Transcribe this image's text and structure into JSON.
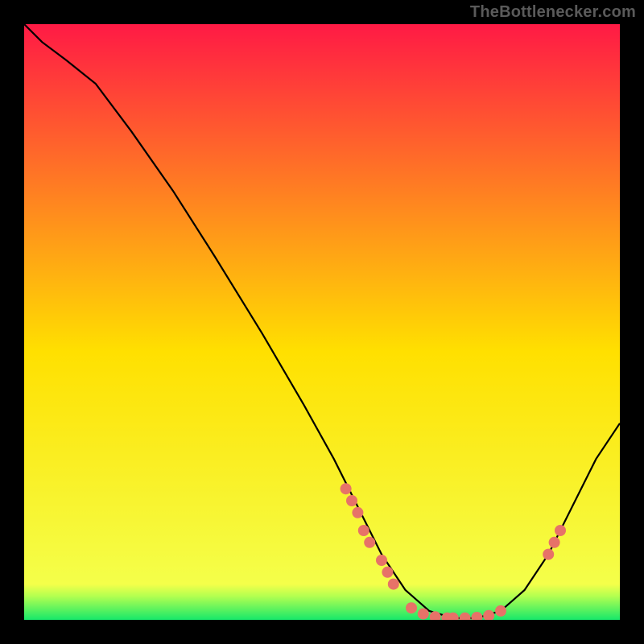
{
  "watermark": "TheBottlenecker.com",
  "chart_data": {
    "type": "line",
    "title": "",
    "xlabel": "",
    "ylabel": "",
    "xlim": [
      0,
      100
    ],
    "ylim": [
      0,
      100
    ],
    "gradient": {
      "top_color": "#ff1a45",
      "mid_color": "#ffe000",
      "bottom_color": "#17e86a",
      "bottom_band_fraction": 0.04
    },
    "curve": [
      {
        "x": 0,
        "y": 100
      },
      {
        "x": 3,
        "y": 97
      },
      {
        "x": 7,
        "y": 94
      },
      {
        "x": 12,
        "y": 90
      },
      {
        "x": 18,
        "y": 82
      },
      {
        "x": 25,
        "y": 72
      },
      {
        "x": 32,
        "y": 61
      },
      {
        "x": 40,
        "y": 48
      },
      {
        "x": 47,
        "y": 36
      },
      {
        "x": 52,
        "y": 27
      },
      {
        "x": 56,
        "y": 19
      },
      {
        "x": 60,
        "y": 11
      },
      {
        "x": 64,
        "y": 5
      },
      {
        "x": 68,
        "y": 1.5
      },
      {
        "x": 72,
        "y": 0.3
      },
      {
        "x": 76,
        "y": 0.3
      },
      {
        "x": 80,
        "y": 1.5
      },
      {
        "x": 84,
        "y": 5
      },
      {
        "x": 88,
        "y": 11
      },
      {
        "x": 92,
        "y": 19
      },
      {
        "x": 96,
        "y": 27
      },
      {
        "x": 100,
        "y": 33
      }
    ],
    "points": [
      {
        "x": 54,
        "y": 22
      },
      {
        "x": 55,
        "y": 20
      },
      {
        "x": 56,
        "y": 18
      },
      {
        "x": 57,
        "y": 15
      },
      {
        "x": 58,
        "y": 13
      },
      {
        "x": 60,
        "y": 10
      },
      {
        "x": 61,
        "y": 8
      },
      {
        "x": 62,
        "y": 6
      },
      {
        "x": 65,
        "y": 2
      },
      {
        "x": 67,
        "y": 1
      },
      {
        "x": 69,
        "y": 0.5
      },
      {
        "x": 71,
        "y": 0.3
      },
      {
        "x": 72,
        "y": 0.3
      },
      {
        "x": 74,
        "y": 0.3
      },
      {
        "x": 76,
        "y": 0.4
      },
      {
        "x": 78,
        "y": 0.7
      },
      {
        "x": 80,
        "y": 1.5
      },
      {
        "x": 88,
        "y": 11
      },
      {
        "x": 89,
        "y": 13
      },
      {
        "x": 90,
        "y": 15
      }
    ],
    "point_color": "#e77268",
    "point_radius": 7
  }
}
